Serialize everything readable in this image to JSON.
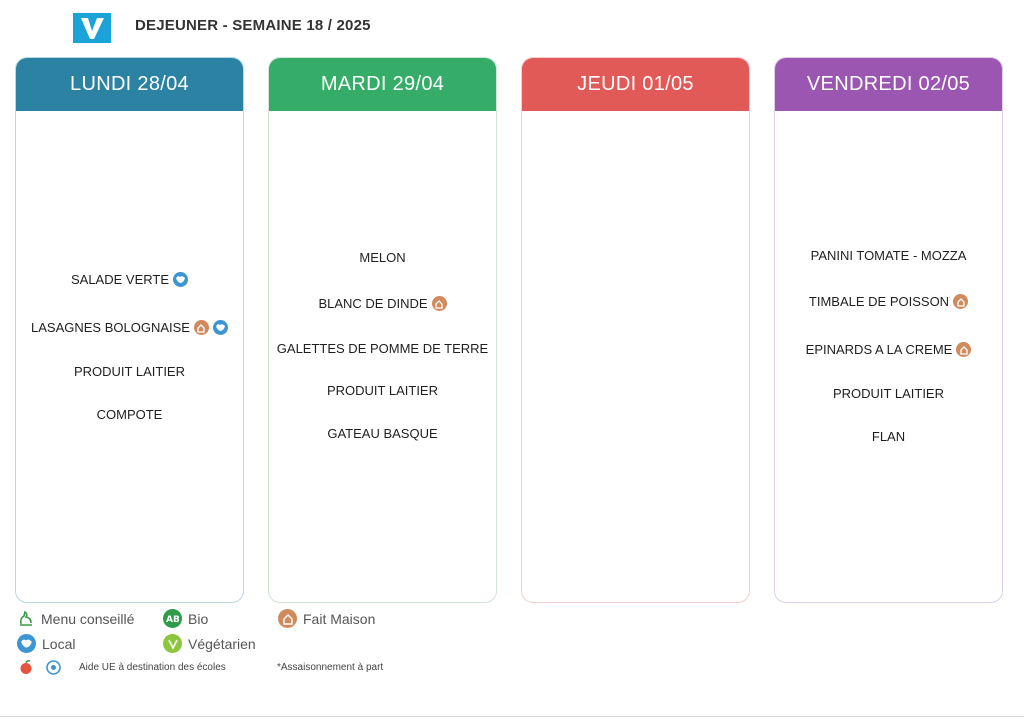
{
  "header": {
    "title": "DEJEUNER - SEMAINE 18 / 2025"
  },
  "days": [
    {
      "label": "LUNDI 28/04",
      "items": [
        "SALADE VERTE",
        "LASAGNES BOLOGNAISE",
        "PRODUIT LAITIER",
        "COMPOTE"
      ]
    },
    {
      "label": "MARDI 29/04",
      "items": [
        "MELON",
        "BLANC DE DINDE",
        "GALETTES DE POMME DE TERRE",
        "PRODUIT LAITIER",
        "GATEAU BASQUE"
      ]
    },
    {
      "label": "JEUDI 01/05",
      "items": []
    },
    {
      "label": "VENDREDI 02/05",
      "items": [
        "PANINI TOMATE - MOZZA",
        "TIMBALE DE POISSON",
        "EPINARDS A LA CREME",
        "PRODUIT LAITIER",
        "FLAN"
      ]
    }
  ],
  "badges": {
    "lundi_0": [
      "local-icon"
    ],
    "lundi_1": [
      "fait-maison-icon",
      "local-icon"
    ],
    "mardi_1": [
      "fait-maison-icon"
    ],
    "vendredi_1": [
      "fait-maison-icon"
    ],
    "vendredi_2": [
      "fait-maison-icon"
    ]
  },
  "legend": {
    "menu_conseille": "Menu conseillé",
    "bio": "Bio",
    "fait_maison": "Fait Maison",
    "local": "Local",
    "vegetarien": "Végétarien",
    "aide_ue": "Aide UE à destination des écoles",
    "assaisonnement": "*Assaisonnement à part"
  },
  "colors": {
    "lundi": "#2b82a3",
    "mardi": "#35ad69",
    "jeudi": "#e25a57",
    "vendredi": "#9a56b1",
    "local": "#3d95d3",
    "fait_maison": "#d08a5e",
    "bio": "#2e9a4a",
    "vegetarien": "#8cc63f",
    "logo": "#1ba3d9"
  }
}
